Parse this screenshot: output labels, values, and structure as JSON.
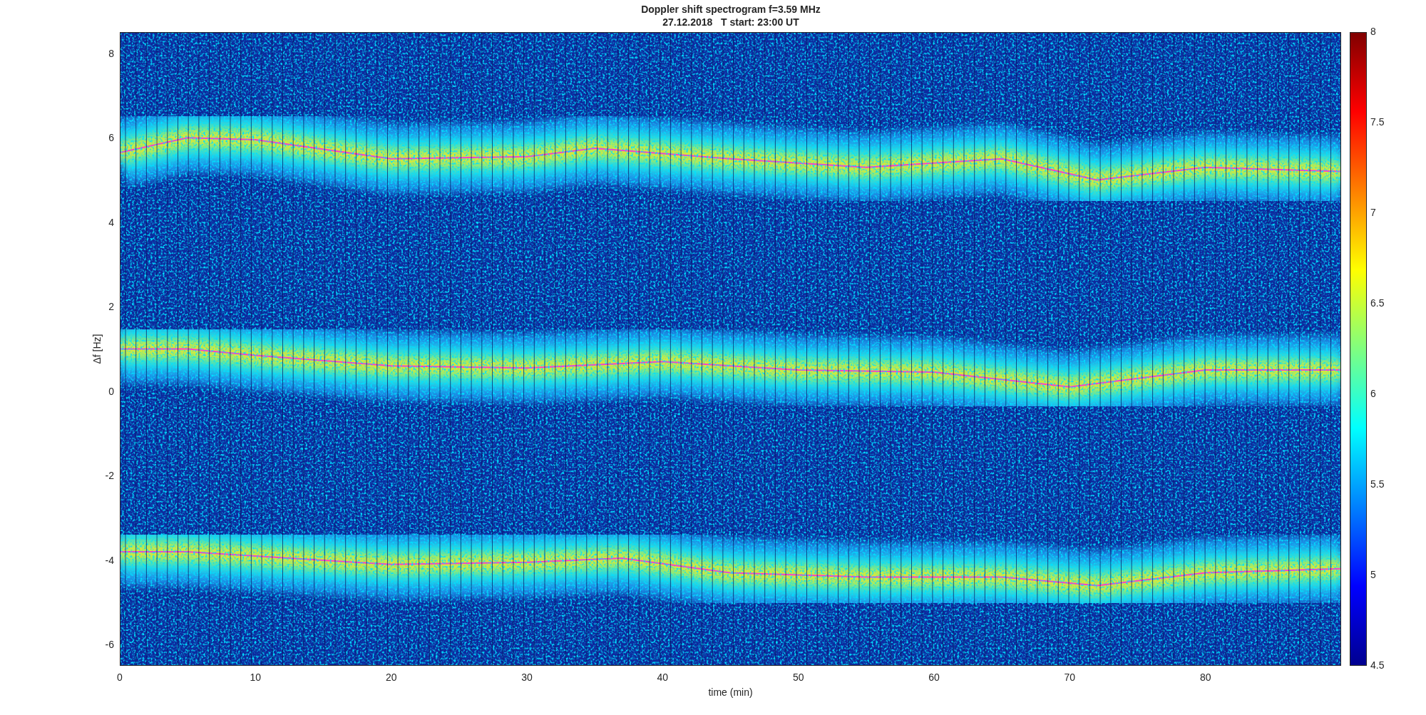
{
  "plot": {
    "title_lines": [
      "Doppler shift spectrogram f=3.59 MHz",
      "27.12.2018   T start: 23:00 UT"
    ],
    "xlabel": "time (min)",
    "ylabel": "Δf [Hz]",
    "xticks": [
      "0",
      "10",
      "20",
      "30",
      "40",
      "50",
      "60",
      "70",
      "80"
    ],
    "yticks": [
      "8",
      "6",
      "4",
      "2",
      "0",
      "-2",
      "-4",
      "-6"
    ],
    "colorbar_ticks": [
      "8",
      "7.5",
      "7",
      "6.5",
      "6",
      "5.5",
      "5",
      "4.5"
    ]
  }
}
